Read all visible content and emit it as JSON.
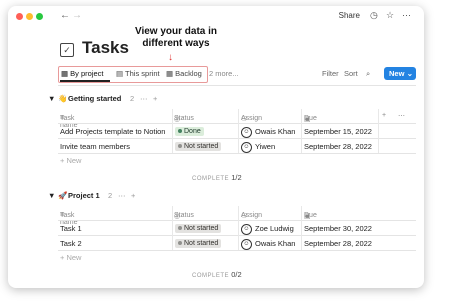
{
  "window": {
    "share_label": "Share",
    "icons": [
      "clock-icon",
      "star-icon",
      "more-icon"
    ]
  },
  "page": {
    "title": "Tasks",
    "icon": "checkbox-icon"
  },
  "callout": {
    "line1": "View your data in",
    "line2": "different ways"
  },
  "views": [
    {
      "label": "By project",
      "icon": "table-icon",
      "active": true
    },
    {
      "label": "This sprint",
      "icon": "board-icon"
    },
    {
      "label": "Backlog",
      "icon": "table-icon"
    }
  ],
  "more_views": "2 more...",
  "toolbar": {
    "filter": "Filter",
    "sort": "Sort",
    "new": "New"
  },
  "columns": {
    "task": "Task name",
    "status": "Status",
    "assign": "Assign",
    "due": "Due"
  },
  "groups": [
    {
      "emoji": "👋",
      "name": "Getting started",
      "count": "2",
      "rows": [
        {
          "task": "Add Projects template to Notion",
          "status": "Done",
          "assign": "Owais Khan",
          "due": "September 15, 2022"
        },
        {
          "task": "Invite team members",
          "status": "Not started",
          "assign": "Yiwen",
          "due": "September 28, 2022"
        }
      ],
      "new_label": "New",
      "complete_label": "COMPLETE",
      "complete_value": "1/2"
    },
    {
      "emoji": "🚀",
      "name": "Project 1",
      "count": "2",
      "rows": [
        {
          "task": "Task 1",
          "status": "Not started",
          "assign": "Zoe Ludwig",
          "due": "September 30, 2022"
        },
        {
          "task": "Task 2",
          "status": "Not started",
          "assign": "Owais Khan",
          "due": "September 28, 2022"
        }
      ],
      "new_label": "New",
      "complete_label": "COMPLETE",
      "complete_value": "0/2"
    }
  ],
  "colors": {
    "accent": "#2383e2",
    "highlight": "#e89a9a",
    "arrow": "#e03030"
  }
}
